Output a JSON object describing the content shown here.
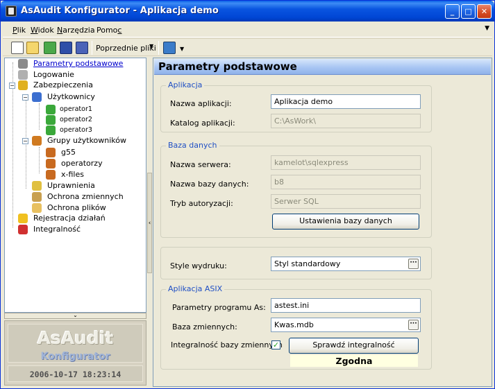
{
  "window": {
    "title": "AsAudit Konfigurator - Aplikacja demo"
  },
  "menu": {
    "items": [
      {
        "label": "Plik",
        "mnemonic": "P",
        "rest": "lik"
      },
      {
        "label": "Widok",
        "mnemonic": "W",
        "rest": "idok"
      },
      {
        "label": "Narzędzia",
        "mnemonic": "N",
        "rest": "arzędzia"
      },
      {
        "label": "Pomoc",
        "mnemonic_pre": "Pomo",
        "mnemonic": "c"
      }
    ]
  },
  "toolbar": {
    "recent_label": "Poprzednie pliki"
  },
  "tree": {
    "items": [
      {
        "label": "Parametry podstawowe",
        "selected": true
      },
      {
        "label": "Logowanie"
      },
      {
        "label": "Zabezpieczenia"
      },
      {
        "label": "Użytkownicy"
      },
      {
        "label": "operator1"
      },
      {
        "label": "operator2"
      },
      {
        "label": "operator3"
      },
      {
        "label": "Grupy użytkowników"
      },
      {
        "label": "g55"
      },
      {
        "label": "operatorzy"
      },
      {
        "label": "x-files"
      },
      {
        "label": "Uprawnienia"
      },
      {
        "label": "Ochrona zmiennych"
      },
      {
        "label": "Ochrona plików"
      },
      {
        "label": "Rejestracja działań"
      },
      {
        "label": "Integralność"
      }
    ]
  },
  "logo": {
    "title": "AsAudit",
    "subtitle": "Konfigurator",
    "datetime": "2006-10-17 18:23:14"
  },
  "panel": {
    "title": "Parametry podstawowe",
    "aplikacja": {
      "legend": "Aplikacja",
      "name_label": "Nazwa aplikacji:",
      "name_value": "Aplikacja demo",
      "dir_label": "Katalog aplikacji:",
      "dir_value": "C:\\AsWork\\"
    },
    "baza": {
      "legend": "Baza danych",
      "server_label": "Nazwa serwera:",
      "server_value": "kamelot\\sqlexpress",
      "db_label": "Nazwa bazy danych:",
      "db_value": "b8",
      "auth_label": "Tryb autoryzacji:",
      "auth_value": "Serwer SQL",
      "settings_button": "Ustawienia bazy danych"
    },
    "style": {
      "label": "Style wydruku:",
      "value": "Styl standardowy"
    },
    "asix": {
      "legend": "Aplikacja ASIX",
      "params_label": "Parametry programu As:",
      "params_value": "astest.ini",
      "vars_label": "Baza zmiennych:",
      "vars_value": "Kwas.mdb",
      "integrity_label": "Integralność bazy zmiennych",
      "integrity_checked": true,
      "check_button": "Sprawdź integralność",
      "status": "Zgodna"
    }
  },
  "colors": {
    "titlebar": "#0a55e0",
    "legend": "#1f4fc4",
    "status_bg": "#ffffe1",
    "check": "#21a121"
  }
}
